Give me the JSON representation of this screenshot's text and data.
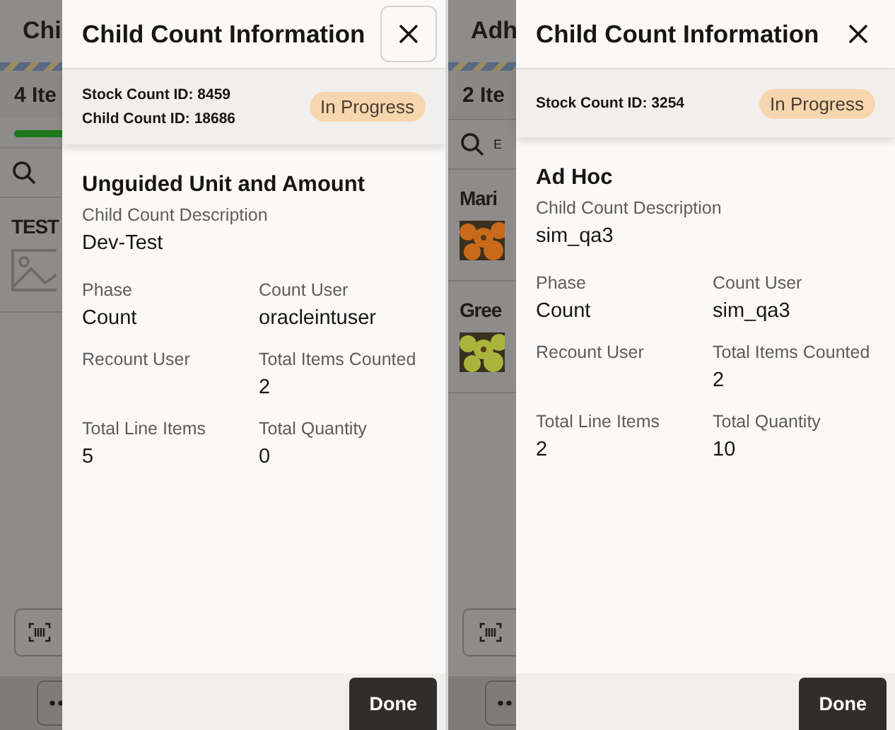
{
  "screens": [
    {
      "background": {
        "title": "Chi",
        "count": "4 Ite",
        "progress": {
          "level": 1
        },
        "items": [
          {
            "name": "TEST",
            "kind": "placeholder"
          }
        ]
      },
      "sheet": {
        "title": "Child Count Information",
        "close": {
          "focused": true
        },
        "ids": [
          "Stock Count ID: 8459",
          "Child Count ID: 18686"
        ],
        "status": "In Progress",
        "type": "Unguided Unit and Amount",
        "description_label": "Child Count Description",
        "description": "Dev-Test",
        "fields": [
          {
            "label": "Phase",
            "value": "Count"
          },
          {
            "label": "Count User",
            "value": "oracleintuser"
          },
          {
            "label": "Recount User"
          },
          {
            "label": "Total Items Counted",
            "value": "2"
          },
          {
            "label": "Total Line Items",
            "value": "5"
          },
          {
            "label": "Total Quantity",
            "value": "0"
          }
        ],
        "done": "Done"
      }
    },
    {
      "background": {
        "title": "Adh",
        "count": "2 Ite",
        "search_hint": "E",
        "items": [
          {
            "name": "Mari",
            "kind": "picture"
          },
          {
            "name": "Gree",
            "kind": "picture"
          }
        ]
      },
      "sheet": {
        "title": "Child Count Information",
        "close": {
          "focused": false
        },
        "ids": [
          "Stock Count ID: 3254"
        ],
        "status": "In Progress",
        "type": "Ad Hoc",
        "description_label": "Child Count Description",
        "description": "sim_qa3",
        "fields": [
          {
            "label": "Phase",
            "value": "Count"
          },
          {
            "label": "Count User",
            "value": "sim_qa3"
          },
          {
            "label": "Recount User"
          },
          {
            "label": "Total Items Counted",
            "value": "2"
          },
          {
            "label": "Total Line Items",
            "value": "2"
          },
          {
            "label": "Total Quantity",
            "value": "10"
          }
        ],
        "done": "Done"
      }
    }
  ]
}
